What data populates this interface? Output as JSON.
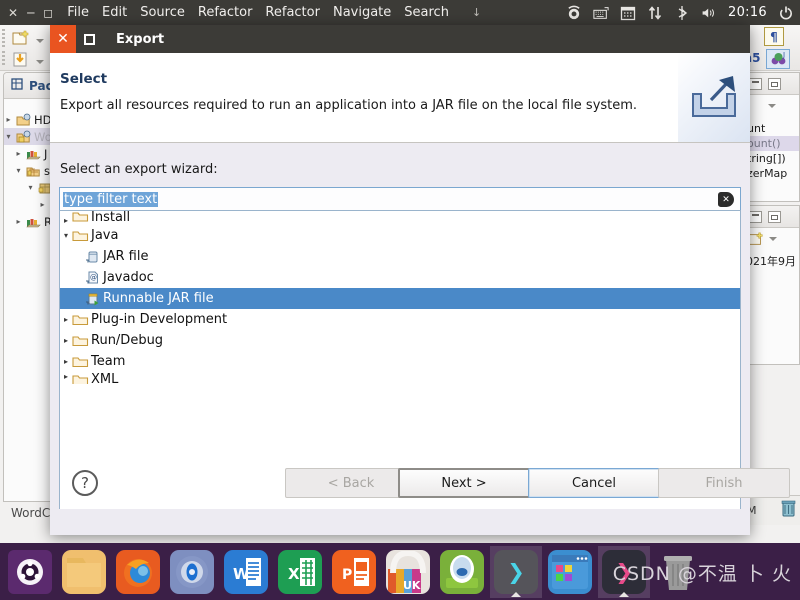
{
  "desktop": {
    "top_panel": {
      "window_controls": [
        "close-x",
        "minimize",
        "maximize"
      ],
      "menu_items": [
        "File",
        "Edit",
        "Source",
        "Refactor",
        "Refactor",
        "Navigate",
        "Search"
      ],
      "overflow_glyph": "↓",
      "tray_icons": [
        "ubuntu-software-icon",
        "keyboard-icon",
        "calendar-icon",
        "network-updown-icon",
        "bluetooth-icon",
        "volume-icon"
      ],
      "clock": "20:16",
      "power_icon": "power-icon",
      "bg_color": "#3c3b37"
    },
    "dock": {
      "bg_color": "#3b1f47",
      "items": [
        {
          "name": "ubuntu-dash",
          "label": "",
          "color": "#5b2a6e"
        },
        {
          "name": "files",
          "label": "",
          "color": "#f0bf6e"
        },
        {
          "name": "firefox",
          "label": "",
          "color": "#e85b20"
        },
        {
          "name": "rhythmbox",
          "label": "",
          "color": "#6d7fb8"
        },
        {
          "name": "word",
          "label": "W",
          "color": "#2b7cd3"
        },
        {
          "name": "excel",
          "label": "X",
          "color": "#1e9e53"
        },
        {
          "name": "powerpoint",
          "label": "P",
          "color": "#f0611f"
        },
        {
          "name": "ubuntu-software",
          "label": "UK",
          "color": "#e5e1dc"
        },
        {
          "name": "eclipse",
          "label": "",
          "color": "#c9d7e8"
        },
        {
          "name": "terminal",
          "label": "❯",
          "color": "#4a4a4a",
          "active": true
        },
        {
          "name": "vmware",
          "label": "",
          "color": "#3b8ed0"
        },
        {
          "name": "powershell",
          "label": "❯",
          "color": "#2d2d38",
          "active": true
        },
        {
          "name": "trash",
          "label": "",
          "color": "#8d8d8d"
        }
      ]
    },
    "watermark": "CSDN @不温 卜 火"
  },
  "eclipse": {
    "toolbar_items": [
      "new-wizard-icon",
      "save-icon"
    ],
    "package_explorer": {
      "title": "Pac",
      "title_icon": "package-explorer-icon",
      "rows": [
        {
          "label": "HD",
          "indent": 0,
          "twisty": "▸",
          "icon": "java-project-icon",
          "selected": false
        },
        {
          "label": "Wo",
          "indent": 0,
          "twisty": "▾",
          "icon": "java-project-icon",
          "selected": true
        },
        {
          "label": "J",
          "indent": 1,
          "twisty": "▸",
          "icon": "jre-library-icon",
          "selected": false
        },
        {
          "label": "sr",
          "indent": 1,
          "twisty": "▾",
          "icon": "source-folder-icon",
          "selected": false
        },
        {
          "label": "",
          "indent": 2,
          "twisty": "▾",
          "icon": "package-icon",
          "selected": false
        },
        {
          "label": "",
          "indent": 3,
          "twisty": "▸",
          "icon": "java-class-icon",
          "selected": false
        },
        {
          "label": "R",
          "indent": 1,
          "twisty": "▸",
          "icon": "referenced-library-icon",
          "selected": false
        }
      ],
      "footer_label": "WordC"
    },
    "outline_panel": {
      "code_lines": [
        "unt",
        "ount()",
        "tring[])",
        "zerMap"
      ],
      "selected_line_index": 1
    },
    "history_panel": {
      "date": "021年9月"
    },
    "status_bar": {
      "left_text": "M",
      "trash_icon": "trash-icon"
    }
  },
  "dialog": {
    "window_title": "Export",
    "close_label": "✕",
    "maximize_label": "maximize-icon",
    "header": {
      "title": "Select",
      "description": "Export all resources required to run an application into a JAR file on the local file system.",
      "banner_icon": "export-arrow-icon"
    },
    "wizard_label": "Select an export wizard:",
    "filter": {
      "value": "type filter text",
      "placeholder": "type filter text",
      "selected": true,
      "clear_icon": "clear-field-icon"
    },
    "tree": [
      {
        "label": "Install",
        "indent": 0,
        "twisty": "▸",
        "icon": "folder-icon",
        "selected": false,
        "clipped_top": true
      },
      {
        "label": "Java",
        "indent": 0,
        "twisty": "▾",
        "icon": "folder-icon",
        "selected": false
      },
      {
        "label": "JAR file",
        "indent": 1,
        "twisty": "",
        "icon": "jar-file-icon",
        "selected": false
      },
      {
        "label": "Javadoc",
        "indent": 1,
        "twisty": "",
        "icon": "javadoc-icon",
        "selected": false
      },
      {
        "label": "Runnable JAR file",
        "indent": 1,
        "twisty": "",
        "icon": "runnable-jar-icon",
        "selected": true
      },
      {
        "label": "Plug-in Development",
        "indent": 0,
        "twisty": "▸",
        "icon": "folder-icon",
        "selected": false
      },
      {
        "label": "Run/Debug",
        "indent": 0,
        "twisty": "▸",
        "icon": "folder-icon",
        "selected": false
      },
      {
        "label": "Team",
        "indent": 0,
        "twisty": "▸",
        "icon": "folder-icon",
        "selected": false
      },
      {
        "label": "XML",
        "indent": 0,
        "twisty": "▸",
        "icon": "folder-icon",
        "selected": false,
        "clipped_bottom": true
      }
    ],
    "buttons": {
      "help": "?",
      "back": "< Back",
      "next": "Next >",
      "cancel": "Cancel",
      "finish": "Finish",
      "back_enabled": false,
      "next_enabled": true,
      "cancel_enabled": true,
      "finish_enabled": false,
      "default_button": "Next >"
    },
    "colors": {
      "selection": "#4a89c8",
      "titlebar": "#3c3b37",
      "close_button": "#e95420",
      "dialog_bg": "#edebf2"
    }
  }
}
